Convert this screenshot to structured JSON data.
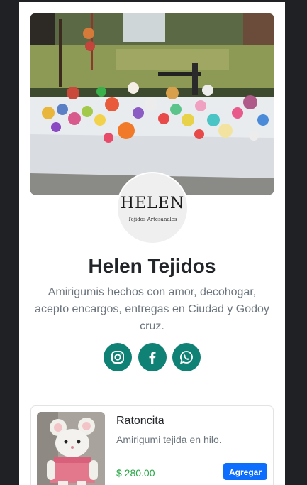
{
  "logo": {
    "main": "HELEN",
    "sub": "Tejidos Artesanales"
  },
  "profile": {
    "name": "Helen Tejidos",
    "description": "Amirigumis hechos con amor, decohogar, acepto encargos, entregas en Ciudad y Godoy cruz."
  },
  "socials": [
    {
      "network": "instagram",
      "icon": "instagram-icon"
    },
    {
      "network": "facebook",
      "icon": "facebook-icon"
    },
    {
      "network": "whatsapp",
      "icon": "whatsapp-icon"
    }
  ],
  "products": [
    {
      "name": "Ratoncita",
      "description": "Amirigumi tejida en hilo.",
      "price": "$ 280.00",
      "button": "Agregar"
    }
  ],
  "colors": {
    "social_bg": "#0f8175",
    "button_bg": "#0d6efd",
    "price": "#28a745",
    "title": "#212529",
    "muted": "#6c757d",
    "frame_bg": "#1f2125"
  }
}
